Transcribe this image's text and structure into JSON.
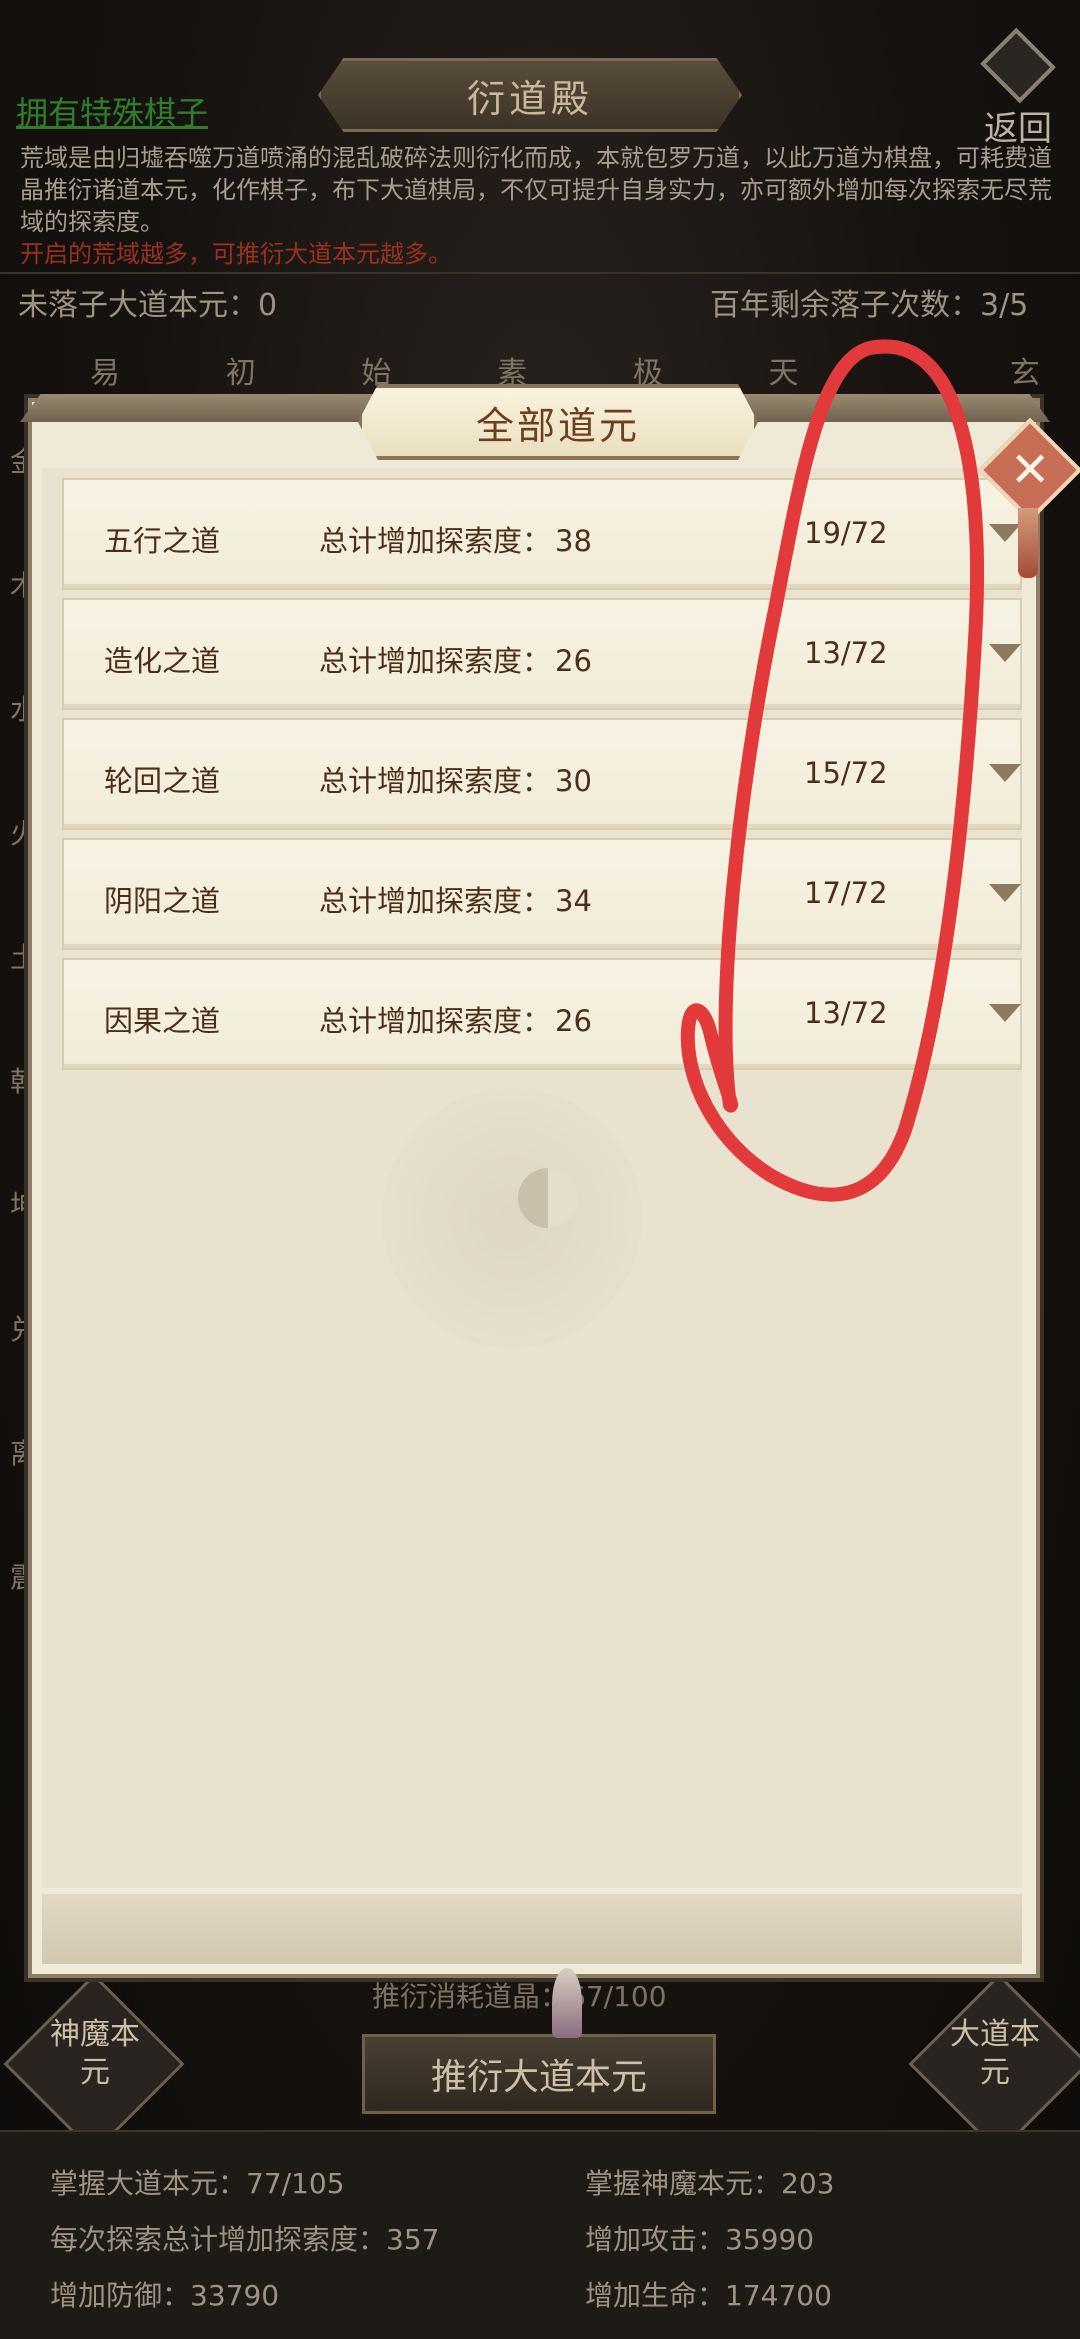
{
  "background": {
    "page_title": "衍道殿",
    "return_label": "返回",
    "special_link": "拥有特殊棋子",
    "intro_text": "荒域是由归墟吞噬万道喷涌的混乱破碎法则衍化而成，本就包罗万道，以此万道为棋盘，可耗费道晶推衍诸道本元，化作棋子，布下大道棋局，不仅可提升自身实力，亦可额外增加每次探索无尽荒域的探索度。",
    "intro_note": "开启的荒域越多，可推衍大道本元越多。",
    "unplaced_label": "未落子大道本元：0",
    "remaining_label": "百年剩余落子次数：3/5",
    "column_headers": [
      "易",
      "初",
      "始",
      "素",
      "极",
      "天",
      "",
      "玄"
    ],
    "row_labels": [
      "金",
      "木",
      "水",
      "火",
      "土",
      "乾",
      "坤",
      "兑",
      "离",
      "震"
    ],
    "left_side_button": "神魔本元",
    "right_side_button": "大道本元",
    "push_info": "推衍消耗道晶：67/100",
    "push_button": "推衍大道本元",
    "stats": {
      "mastered_dao": "掌握大道本元：77/105",
      "mastered_demon": "掌握神魔本元：203",
      "explore_bonus": "每次探索总计增加探索度：357",
      "attack": "增加攻击：35990",
      "defense": "增加防御：33790",
      "life": "增加生命：174700"
    }
  },
  "modal": {
    "title": "全部道元",
    "close_icon": "close-x-icon",
    "rows": [
      {
        "name": "五行之道",
        "bonus_label": "总计增加探索度：",
        "bonus_value": "38",
        "progress": "19/72"
      },
      {
        "name": "造化之道",
        "bonus_label": "总计增加探索度：",
        "bonus_value": "26",
        "progress": "13/72"
      },
      {
        "name": "轮回之道",
        "bonus_label": "总计增加探索度：",
        "bonus_value": "30",
        "progress": "15/72"
      },
      {
        "name": "阴阳之道",
        "bonus_label": "总计增加探索度：",
        "bonus_value": "34",
        "progress": "17/72"
      },
      {
        "name": "因果之道",
        "bonus_label": "总计增加探索度：",
        "bonus_value": "26",
        "progress": "13/72"
      }
    ]
  },
  "colors": {
    "annotation": "#e23a3a",
    "modal_bg": "#efe9d8",
    "row_text": "#4b2f1a",
    "title_text": "#6d3f1f"
  }
}
